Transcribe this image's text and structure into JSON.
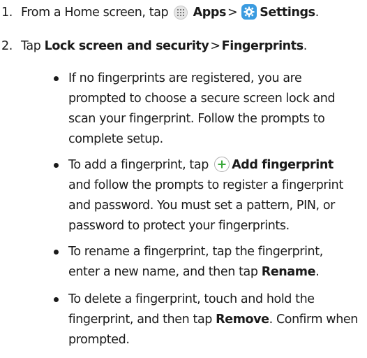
{
  "steps": [
    {
      "number": "1.",
      "text_before": "From a Home screen, tap",
      "apps_label": "Apps",
      "separator": ">",
      "settings_label": "Settings",
      "text_after": "."
    },
    {
      "number": "2.",
      "text_before": "Tap",
      "lock_label": "Lock screen and security",
      "separator": ">",
      "fingerprints_label": "Fingerprints",
      "text_after": "."
    }
  ],
  "bullets": [
    {
      "lines": [
        "If no fingerprints are registered, you are",
        "prompted to choose a secure screen lock and",
        "scan your fingerprint. Follow the prompts to",
        "complete setup."
      ]
    },
    {
      "first_before": "To add a fingerprint, tap",
      "add_label": "Add fingerprint",
      "lines": [
        "and follow the prompts to register a fingerprint",
        "and password. You must set a pattern, PIN, or",
        "password to protect your fingerprints."
      ]
    },
    {
      "lines": [
        "To rename a fingerprint, tap the fingerprint,"
      ],
      "last_before": "enter a new name, and then tap",
      "rename_label": "Rename",
      "last_after": "."
    },
    {
      "lines": [
        "To delete a fingerprint, touch and hold the"
      ],
      "mid_before": "fingerprint, and then tap",
      "remove_label": "Remove",
      "mid_after": ". Confirm when",
      "end_lines": [
        "prompted."
      ]
    }
  ],
  "icons": {
    "apps": "apps-icon",
    "settings": "settings-icon",
    "add": "add-circle-icon"
  },
  "colors": {
    "text": "#1a1a1a",
    "settings_icon_bg": "#3a9be0",
    "plus_green": "#3aa83a"
  }
}
